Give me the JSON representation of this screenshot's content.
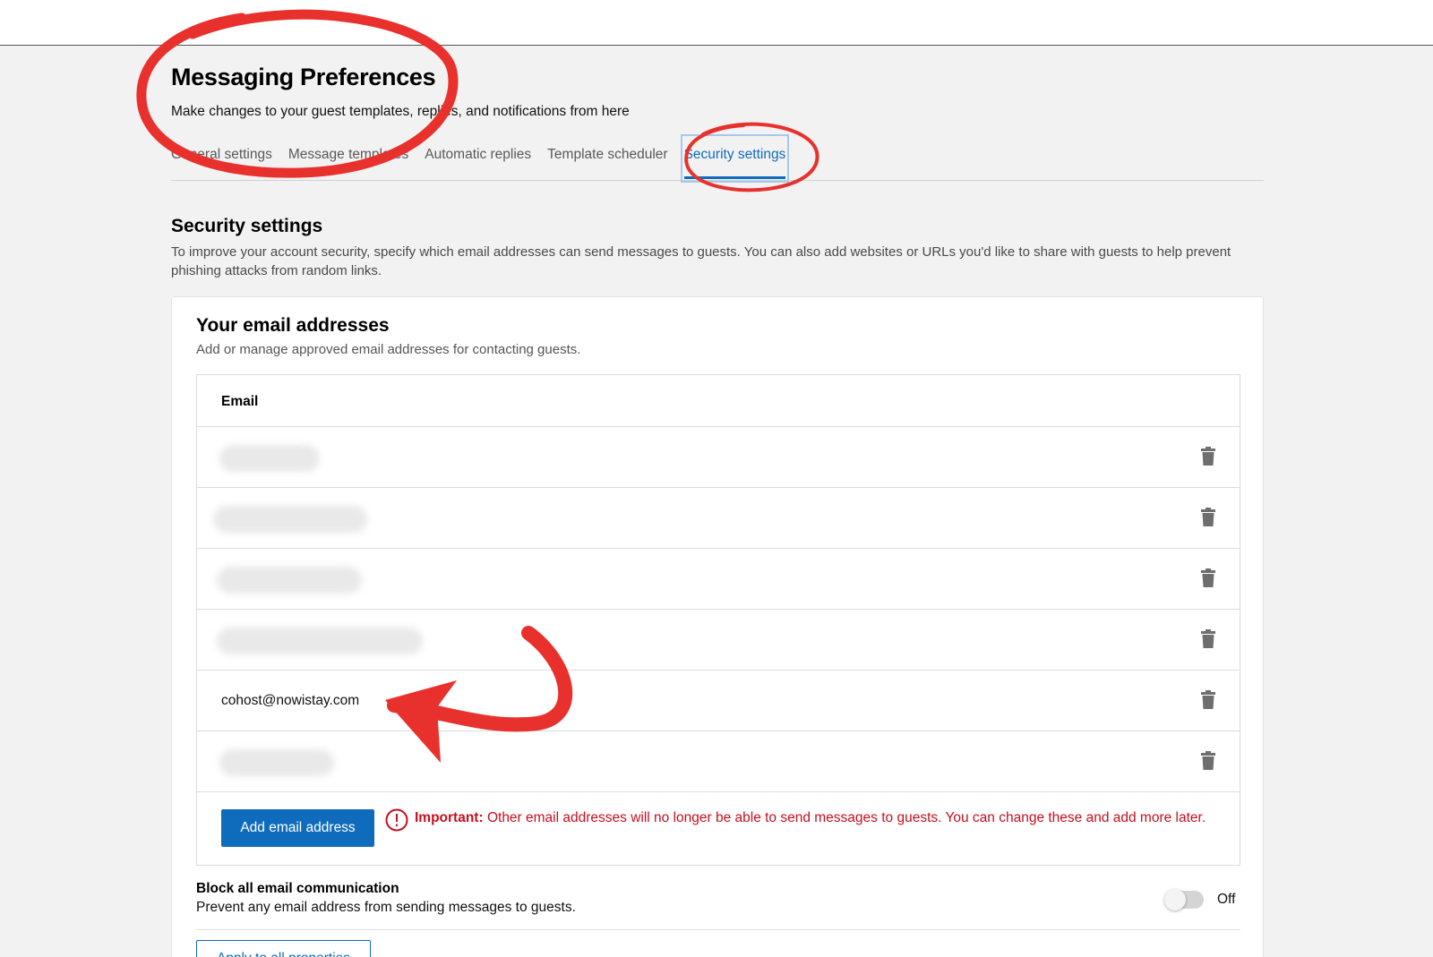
{
  "header": {
    "title": "Messaging Preferences",
    "subtitle": "Make changes to your guest templates, replies, and notifications from here"
  },
  "tabs": [
    {
      "label": "General settings",
      "active": false
    },
    {
      "label": "Message templates",
      "active": false
    },
    {
      "label": "Automatic replies",
      "active": false
    },
    {
      "label": "Template scheduler",
      "active": false
    },
    {
      "label": "Security settings",
      "active": true
    }
  ],
  "security": {
    "title": "Security settings",
    "description": "To improve your account security, specify which email addresses can send messages to guests. You can also add websites or URLs you'd like to share with guests to help prevent phishing attacks from random links."
  },
  "email_card": {
    "title": "Your email addresses",
    "description": "Add or manage approved email addresses for contacting guests.",
    "column_header": "Email",
    "rows": [
      {
        "email": "",
        "redacted": true
      },
      {
        "email": "",
        "redacted": true
      },
      {
        "email": "",
        "redacted": true
      },
      {
        "email": "",
        "redacted": true
      },
      {
        "email": "cohost@nowistay.com",
        "redacted": false
      },
      {
        "email": "",
        "redacted": true
      }
    ],
    "add_button": "Add email address",
    "warning_label": "Important:",
    "warning_text": "Other email addresses will no longer be able to send messages to guests. You can change these and add more later."
  },
  "block_all": {
    "title": "Block all email communication",
    "description": "Prevent any email address from sending messages to guests.",
    "toggle_state": "Off"
  },
  "apply_button": "Apply to all properties",
  "colors": {
    "accent": "#0f6cbd",
    "warning": "#c50f1f",
    "annotation": "#e8312c"
  }
}
